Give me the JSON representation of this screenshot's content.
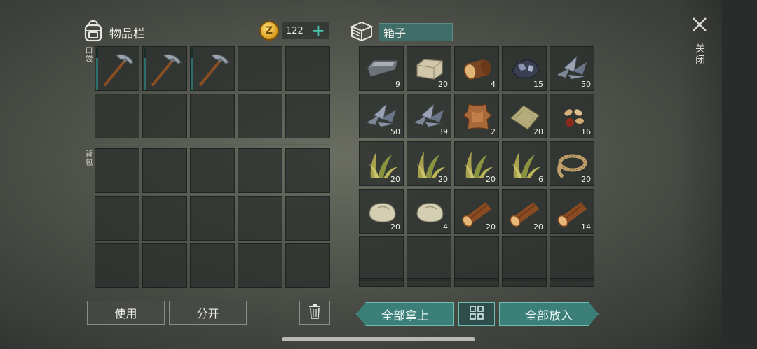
{
  "inventory": {
    "title": "物品栏",
    "coins": "122",
    "coin_symbol": "Z",
    "pocket_label": "口袋",
    "backpack_label": "背包",
    "pocket_slots": [
      {
        "item": "pickaxe"
      },
      {
        "item": "pickaxe"
      },
      {
        "item": "pickaxe"
      },
      {
        "item": ""
      },
      {
        "item": ""
      },
      {
        "item": ""
      },
      {
        "item": ""
      },
      {
        "item": ""
      },
      {
        "item": ""
      },
      {
        "item": ""
      }
    ],
    "backpack_slots_count": 15
  },
  "box": {
    "name": "箱子",
    "slots": [
      {
        "item": "iron-ingot",
        "qty": "9"
      },
      {
        "item": "stone-block",
        "qty": "20"
      },
      {
        "item": "log",
        "qty": "4"
      },
      {
        "item": "iron-ore",
        "qty": "15"
      },
      {
        "item": "metal-scrap",
        "qty": "50"
      },
      {
        "item": "metal-scrap",
        "qty": "50"
      },
      {
        "item": "metal-scrap",
        "qty": "39"
      },
      {
        "item": "leather",
        "qty": "2"
      },
      {
        "item": "cloth",
        "qty": "20"
      },
      {
        "item": "seeds",
        "qty": "16"
      },
      {
        "item": "plant-fiber",
        "qty": "20"
      },
      {
        "item": "plant-fiber",
        "qty": "20"
      },
      {
        "item": "plant-fiber",
        "qty": "20"
      },
      {
        "item": "plant-fiber",
        "qty": "6"
      },
      {
        "item": "rope",
        "qty": "20"
      },
      {
        "item": "stone",
        "qty": "20"
      },
      {
        "item": "stone",
        "qty": "4"
      },
      {
        "item": "wood",
        "qty": "20"
      },
      {
        "item": "wood",
        "qty": "20"
      },
      {
        "item": "wood",
        "qty": "14"
      },
      {
        "item": "",
        "qty": ""
      },
      {
        "item": "",
        "qty": ""
      },
      {
        "item": "",
        "qty": ""
      },
      {
        "item": "",
        "qty": ""
      },
      {
        "item": "",
        "qty": ""
      }
    ]
  },
  "actions": {
    "use": "使用",
    "split": "分开",
    "take_all": "全部拿上",
    "put_all": "全部放入",
    "close": "关闭"
  },
  "colors": {
    "accent": "#3c7f78",
    "coin": "#d99c1c"
  }
}
